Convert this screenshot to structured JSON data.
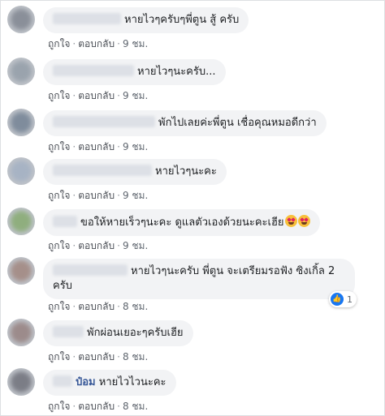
{
  "actions": {
    "like": "ถูกใจ",
    "reply": "ตอบกลับ",
    "separator": "·"
  },
  "comments": [
    {
      "text": "หายไวๆครับๆพี่ตูน สู้ ครับ",
      "time": "9 ชม.",
      "avatar_color": "#8a8f99"
    },
    {
      "text": "หายไวๆนะครับ...",
      "time": "9 ชม.",
      "avatar_color": "#9aa3ad"
    },
    {
      "text": "พักไปเลยค่ะพี่ตูน เชื่อคุณหมอดีกว่า",
      "time": "9 ชม.",
      "avatar_color": "#7f8c9c"
    },
    {
      "text": "หายไวๆนะคะ",
      "time": "9 ชม.",
      "avatar_color": "#a7b3c4"
    },
    {
      "text": "ขอให้หายเร็วๆนะคะ ดูแลตัวเองด้วยนะคะเฮีย",
      "time": "9 ชม.",
      "avatar_color": "#8fae7e"
    },
    {
      "text": "หายไวๆนะครับ พี่ตูน จะเตรียมรอฟัง ซิงเกิ้ล 2 ครับ",
      "time": "8 ชม.",
      "avatar_color": "#a58f8a",
      "reaction_count": "1"
    },
    {
      "text": "พักผ่อนเยอะๆครับเฮีย",
      "time": "8 ชม.",
      "avatar_color": "#9c8b8b"
    },
    {
      "name": "ป๋อม",
      "text": "หายไวไวนะคะ",
      "time": "8 ชม.",
      "avatar_color": "#7b7d86"
    }
  ]
}
